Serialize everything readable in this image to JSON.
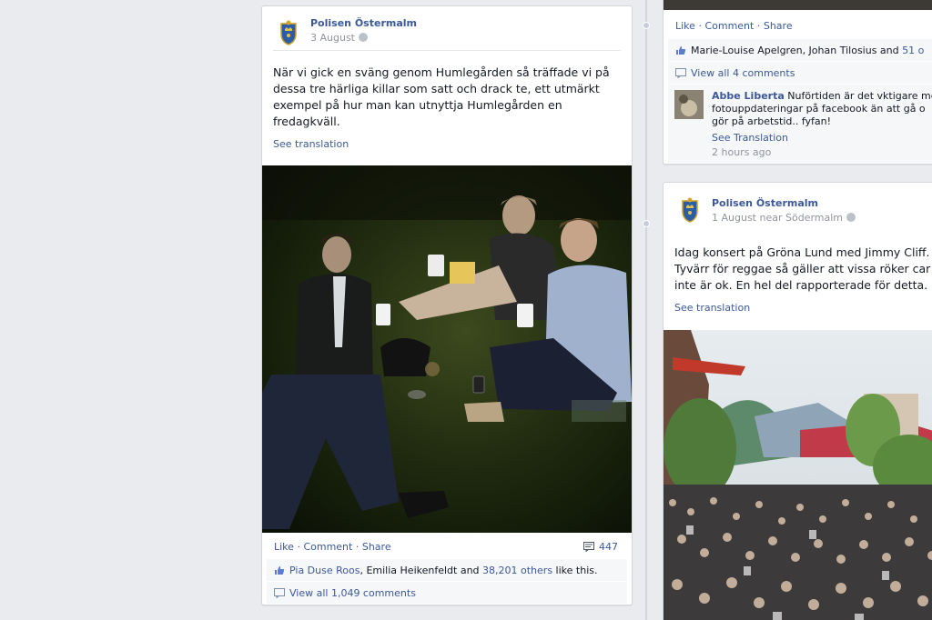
{
  "left_post": {
    "author": "Polisen Östermalm",
    "date": "3 August",
    "text_lines": [
      "När vi gick en sväng genom Humlegården så träffade vi på",
      "dessa tre härliga killar som satt och drack te, ett utmärkt",
      "exempel på hur man kan utnyttja Humlegården en",
      "fredagkväll."
    ],
    "see_translation": "See translation",
    "actions": {
      "like": "Like",
      "comment": "Comment",
      "share": "Share",
      "sep": "·"
    },
    "comment_count": "447",
    "likes": {
      "name1": "Pia Duse Roos",
      "middle": ", Emilia Heikenfeldt and ",
      "others": "38,201 others",
      "suffix": " like this."
    },
    "view_all": "View all 1,049 comments"
  },
  "right_top_post": {
    "actions": {
      "like": "Like",
      "comment": "Comment",
      "share": "Share",
      "sep": "·"
    },
    "likes": {
      "names": "Marie-Louise Apelgren, Johan Tilosius and ",
      "others": "51 o"
    },
    "view_all": "View all 4 comments",
    "comment": {
      "author": "Abbe Liberta",
      "text_line1": " Nuförtiden är det vktigare med",
      "text_line2": "fotouppdateringar på facebook än att gå o",
      "text_line3": "gör på arbetstid.. fyfan!",
      "see_translation": "See Translation",
      "time": "2 hours ago"
    }
  },
  "right_bottom_post": {
    "author": "Polisen Östermalm",
    "date": "1 August near Södermalm",
    "text_lines": [
      "Idag konsert på Gröna Lund med Jimmy Cliff.",
      "Tyvärr för reggae så gäller att vissa röker car",
      "inte är ok. En hel del rapporterade för detta."
    ],
    "see_translation": "See translation"
  },
  "colors": {
    "link": "#3b5998",
    "meta": "#90949c",
    "background": "#e9ebee"
  }
}
